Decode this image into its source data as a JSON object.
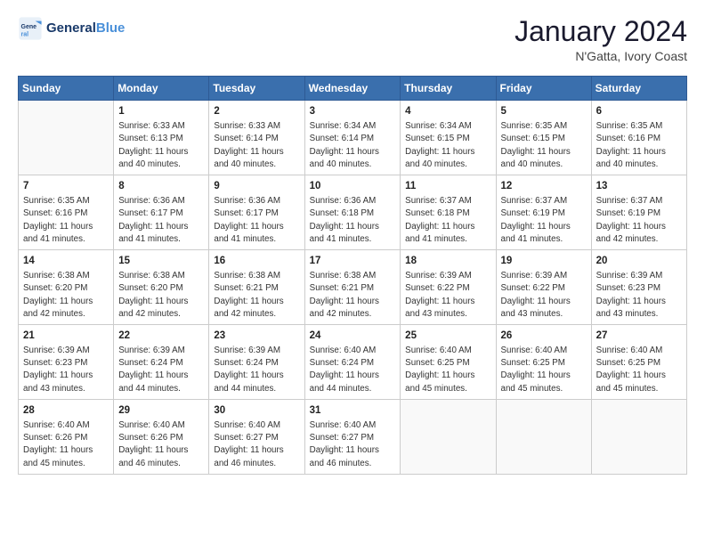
{
  "header": {
    "logo_line1": "General",
    "logo_line2": "Blue",
    "month_year": "January 2024",
    "location": "N'Gatta, Ivory Coast"
  },
  "days_of_week": [
    "Sunday",
    "Monday",
    "Tuesday",
    "Wednesday",
    "Thursday",
    "Friday",
    "Saturday"
  ],
  "weeks": [
    [
      {
        "num": "",
        "detail": ""
      },
      {
        "num": "1",
        "detail": "Sunrise: 6:33 AM\nSunset: 6:13 PM\nDaylight: 11 hours\nand 40 minutes."
      },
      {
        "num": "2",
        "detail": "Sunrise: 6:33 AM\nSunset: 6:14 PM\nDaylight: 11 hours\nand 40 minutes."
      },
      {
        "num": "3",
        "detail": "Sunrise: 6:34 AM\nSunset: 6:14 PM\nDaylight: 11 hours\nand 40 minutes."
      },
      {
        "num": "4",
        "detail": "Sunrise: 6:34 AM\nSunset: 6:15 PM\nDaylight: 11 hours\nand 40 minutes."
      },
      {
        "num": "5",
        "detail": "Sunrise: 6:35 AM\nSunset: 6:15 PM\nDaylight: 11 hours\nand 40 minutes."
      },
      {
        "num": "6",
        "detail": "Sunrise: 6:35 AM\nSunset: 6:16 PM\nDaylight: 11 hours\nand 40 minutes."
      }
    ],
    [
      {
        "num": "7",
        "detail": "Sunrise: 6:35 AM\nSunset: 6:16 PM\nDaylight: 11 hours\nand 41 minutes."
      },
      {
        "num": "8",
        "detail": "Sunrise: 6:36 AM\nSunset: 6:17 PM\nDaylight: 11 hours\nand 41 minutes."
      },
      {
        "num": "9",
        "detail": "Sunrise: 6:36 AM\nSunset: 6:17 PM\nDaylight: 11 hours\nand 41 minutes."
      },
      {
        "num": "10",
        "detail": "Sunrise: 6:36 AM\nSunset: 6:18 PM\nDaylight: 11 hours\nand 41 minutes."
      },
      {
        "num": "11",
        "detail": "Sunrise: 6:37 AM\nSunset: 6:18 PM\nDaylight: 11 hours\nand 41 minutes."
      },
      {
        "num": "12",
        "detail": "Sunrise: 6:37 AM\nSunset: 6:19 PM\nDaylight: 11 hours\nand 41 minutes."
      },
      {
        "num": "13",
        "detail": "Sunrise: 6:37 AM\nSunset: 6:19 PM\nDaylight: 11 hours\nand 42 minutes."
      }
    ],
    [
      {
        "num": "14",
        "detail": "Sunrise: 6:38 AM\nSunset: 6:20 PM\nDaylight: 11 hours\nand 42 minutes."
      },
      {
        "num": "15",
        "detail": "Sunrise: 6:38 AM\nSunset: 6:20 PM\nDaylight: 11 hours\nand 42 minutes."
      },
      {
        "num": "16",
        "detail": "Sunrise: 6:38 AM\nSunset: 6:21 PM\nDaylight: 11 hours\nand 42 minutes."
      },
      {
        "num": "17",
        "detail": "Sunrise: 6:38 AM\nSunset: 6:21 PM\nDaylight: 11 hours\nand 42 minutes."
      },
      {
        "num": "18",
        "detail": "Sunrise: 6:39 AM\nSunset: 6:22 PM\nDaylight: 11 hours\nand 43 minutes."
      },
      {
        "num": "19",
        "detail": "Sunrise: 6:39 AM\nSunset: 6:22 PM\nDaylight: 11 hours\nand 43 minutes."
      },
      {
        "num": "20",
        "detail": "Sunrise: 6:39 AM\nSunset: 6:23 PM\nDaylight: 11 hours\nand 43 minutes."
      }
    ],
    [
      {
        "num": "21",
        "detail": "Sunrise: 6:39 AM\nSunset: 6:23 PM\nDaylight: 11 hours\nand 43 minutes."
      },
      {
        "num": "22",
        "detail": "Sunrise: 6:39 AM\nSunset: 6:24 PM\nDaylight: 11 hours\nand 44 minutes."
      },
      {
        "num": "23",
        "detail": "Sunrise: 6:39 AM\nSunset: 6:24 PM\nDaylight: 11 hours\nand 44 minutes."
      },
      {
        "num": "24",
        "detail": "Sunrise: 6:40 AM\nSunset: 6:24 PM\nDaylight: 11 hours\nand 44 minutes."
      },
      {
        "num": "25",
        "detail": "Sunrise: 6:40 AM\nSunset: 6:25 PM\nDaylight: 11 hours\nand 45 minutes."
      },
      {
        "num": "26",
        "detail": "Sunrise: 6:40 AM\nSunset: 6:25 PM\nDaylight: 11 hours\nand 45 minutes."
      },
      {
        "num": "27",
        "detail": "Sunrise: 6:40 AM\nSunset: 6:25 PM\nDaylight: 11 hours\nand 45 minutes."
      }
    ],
    [
      {
        "num": "28",
        "detail": "Sunrise: 6:40 AM\nSunset: 6:26 PM\nDaylight: 11 hours\nand 45 minutes."
      },
      {
        "num": "29",
        "detail": "Sunrise: 6:40 AM\nSunset: 6:26 PM\nDaylight: 11 hours\nand 46 minutes."
      },
      {
        "num": "30",
        "detail": "Sunrise: 6:40 AM\nSunset: 6:27 PM\nDaylight: 11 hours\nand 46 minutes."
      },
      {
        "num": "31",
        "detail": "Sunrise: 6:40 AM\nSunset: 6:27 PM\nDaylight: 11 hours\nand 46 minutes."
      },
      {
        "num": "",
        "detail": ""
      },
      {
        "num": "",
        "detail": ""
      },
      {
        "num": "",
        "detail": ""
      }
    ]
  ]
}
